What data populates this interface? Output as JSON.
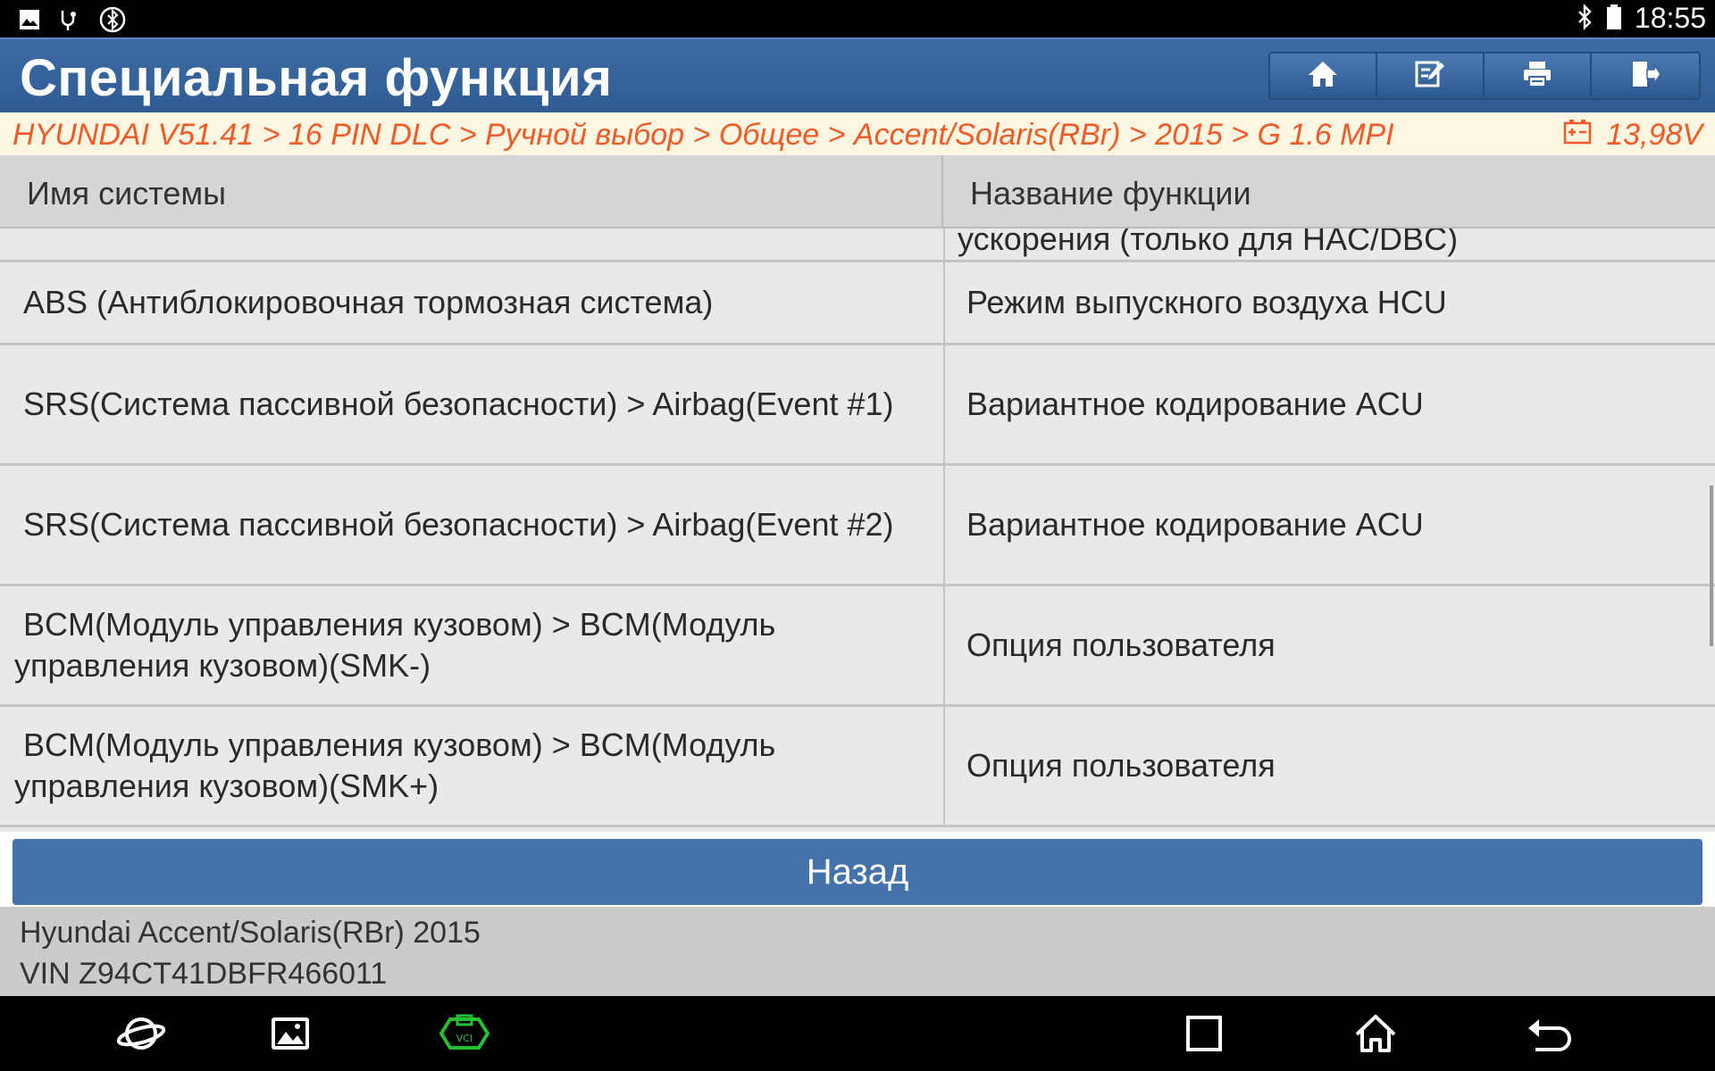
{
  "status_bar": {
    "time": "18:55",
    "left_icons": [
      "image-icon",
      "usb-debug-icon",
      "bluetooth-circle-icon"
    ],
    "right_icons": [
      "bluetooth-icon",
      "battery-icon"
    ]
  },
  "header": {
    "title": "Специальная функция",
    "toolbar": [
      "home-icon",
      "edit-icon",
      "print-icon",
      "exit-icon"
    ],
    "accent": "#3a669d"
  },
  "breadcrumb": {
    "path": "HYUNDAI V51.41 > 16 PIN DLC > Ручной выбор > Общее > Accent/Solaris(RBr) > 2015 > G 1.6 MPI",
    "voltage": "13,98V",
    "color": "#f05a28"
  },
  "table": {
    "columns": [
      "Имя системы",
      "Название функции"
    ],
    "partial_row": {
      "system": "",
      "function": "ускорения (только для HAC/DBC)"
    },
    "rows": [
      {
        "system": "ABS (Антиблокировочная тормозная система)",
        "function": "Режим выпускного воздуха HCU"
      },
      {
        "system": "SRS(Система пассивной безопасности) > Airbag(Event #1)",
        "function": "Вариантное кодирование ACU"
      },
      {
        "system": "SRS(Система пассивной безопасности) > Airbag(Event #2)",
        "function": "Вариантное кодирование ACU"
      },
      {
        "system": "BCM(Модуль управления кузовом) > BCM(Модуль управления кузовом)(SMK-)",
        "function": "Опция пользователя"
      },
      {
        "system": "BCM(Модуль управления кузовом) > BCM(Модуль управления кузовом)(SMK+)",
        "function": "Опция пользователя"
      }
    ]
  },
  "back_button": {
    "label": "Назад"
  },
  "vehicle": {
    "model": "Hyundai Accent/Solaris(RBr) 2015",
    "vin": "VIN Z94CT41DBFR466011"
  },
  "navbar": [
    "browser-icon",
    "gallery-icon",
    "vci-icon",
    "recents-icon",
    "home-icon",
    "back-icon"
  ]
}
